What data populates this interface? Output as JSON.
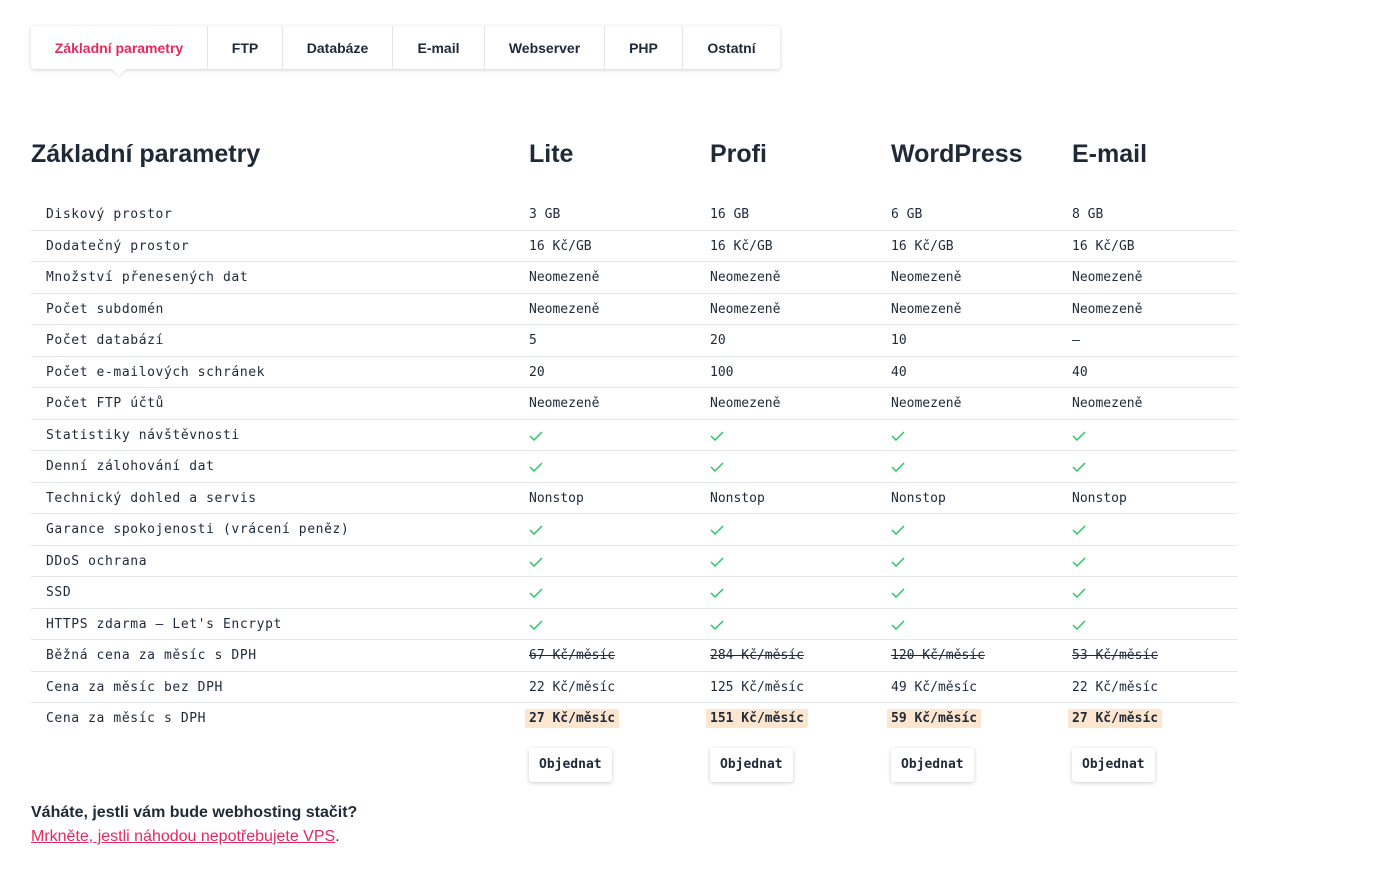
{
  "tabs": [
    {
      "label": "Základní parametry",
      "active": true
    },
    {
      "label": "FTP",
      "active": false
    },
    {
      "label": "Databáze",
      "active": false
    },
    {
      "label": "E-mail",
      "active": false
    },
    {
      "label": "Webserver",
      "active": false
    },
    {
      "label": "PHP",
      "active": false
    },
    {
      "label": "Ostatní",
      "active": false
    }
  ],
  "section_title": "Základní parametry",
  "plans": [
    "Lite",
    "Profi",
    "WordPress",
    "E-mail"
  ],
  "rows": [
    {
      "label": "Diskový prostor",
      "values": [
        "3 GB",
        "16 GB",
        "6 GB",
        "8 GB"
      ]
    },
    {
      "label": "Dodatečný prostor",
      "values": [
        "16 Kč/GB",
        "16 Kč/GB",
        "16 Kč/GB",
        "16 Kč/GB"
      ]
    },
    {
      "label": "Množství přenesených dat",
      "values": [
        "Neomezeně",
        "Neomezeně",
        "Neomezeně",
        "Neomezeně"
      ]
    },
    {
      "label": "Počet subdomén",
      "values": [
        "Neomezeně",
        "Neomezeně",
        "Neomezeně",
        "Neomezeně"
      ]
    },
    {
      "label": "Počet databází",
      "values": [
        "5",
        "20",
        "10",
        "–"
      ]
    },
    {
      "label": "Počet e-mailových schránek",
      "values": [
        "20",
        "100",
        "40",
        "40"
      ]
    },
    {
      "label": "Počet FTP účtů",
      "values": [
        "Neomezeně",
        "Neomezeně",
        "Neomezeně",
        "Neomezeně"
      ]
    },
    {
      "label": "Statistiky návštěvnosti",
      "check": true
    },
    {
      "label": "Denní zálohování dat",
      "check": true
    },
    {
      "label": "Technický dohled a servis",
      "values": [
        "Nonstop",
        "Nonstop",
        "Nonstop",
        "Nonstop"
      ]
    },
    {
      "label": "Garance spokojenosti (vrácení peněz)",
      "check": true
    },
    {
      "label": "DDoS ochrana",
      "check": true
    },
    {
      "label": "SSD",
      "check": true
    },
    {
      "label": "HTTPS zdarma – Let's Encrypt",
      "check": true
    },
    {
      "label": "Běžná cena za měsíc s DPH",
      "values": [
        "67 Kč/měsíc",
        "284 Kč/měsíc",
        "120 Kč/měsíc",
        "53 Kč/měsíc"
      ],
      "style": "strike"
    },
    {
      "label": "Cena za měsíc bez DPH",
      "values": [
        "22 Kč/měsíc",
        "125 Kč/měsíc",
        "49 Kč/měsíc",
        "22 Kč/měsíc"
      ]
    },
    {
      "label": "Cena za měsíc s DPH",
      "values": [
        "27 Kč/měsíc",
        "151 Kč/měsíc",
        "59 Kč/měsíc",
        "27 Kč/měsíc"
      ],
      "style": "highlight"
    }
  ],
  "order_label": "Objednat",
  "footer": {
    "question": "Váháte, jestli vám bude webhosting stačit?",
    "link_text": "Mrkněte, jestli náhodou nepotřebujete VPS",
    "trailing": "."
  },
  "colors": {
    "accent": "#e8275f",
    "check": "#22c55e",
    "highlight": "#fde6cf"
  }
}
